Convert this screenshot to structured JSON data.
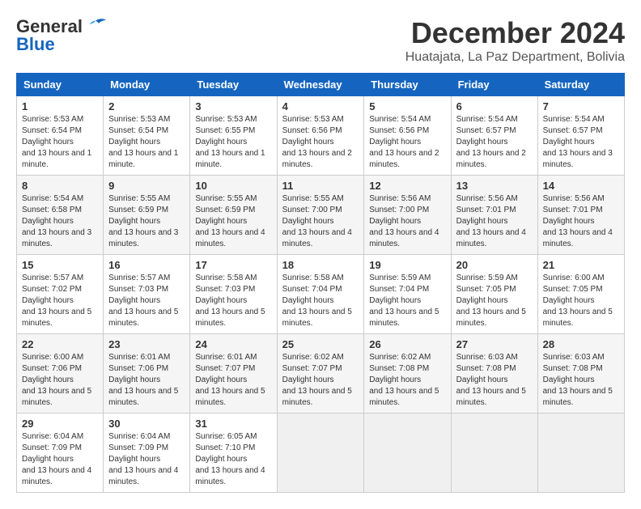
{
  "logo": {
    "line1": "General",
    "line2": "Blue"
  },
  "title": "December 2024",
  "subtitle": "Huatajata, La Paz Department, Bolivia",
  "days_of_week": [
    "Sunday",
    "Monday",
    "Tuesday",
    "Wednesday",
    "Thursday",
    "Friday",
    "Saturday"
  ],
  "weeks": [
    [
      {
        "day": "1",
        "sunrise": "5:53 AM",
        "sunset": "6:54 PM",
        "daylight": "13 hours and 1 minute."
      },
      {
        "day": "2",
        "sunrise": "5:53 AM",
        "sunset": "6:54 PM",
        "daylight": "13 hours and 1 minute."
      },
      {
        "day": "3",
        "sunrise": "5:53 AM",
        "sunset": "6:55 PM",
        "daylight": "13 hours and 1 minute."
      },
      {
        "day": "4",
        "sunrise": "5:53 AM",
        "sunset": "6:56 PM",
        "daylight": "13 hours and 2 minutes."
      },
      {
        "day": "5",
        "sunrise": "5:54 AM",
        "sunset": "6:56 PM",
        "daylight": "13 hours and 2 minutes."
      },
      {
        "day": "6",
        "sunrise": "5:54 AM",
        "sunset": "6:57 PM",
        "daylight": "13 hours and 2 minutes."
      },
      {
        "day": "7",
        "sunrise": "5:54 AM",
        "sunset": "6:57 PM",
        "daylight": "13 hours and 3 minutes."
      }
    ],
    [
      {
        "day": "8",
        "sunrise": "5:54 AM",
        "sunset": "6:58 PM",
        "daylight": "13 hours and 3 minutes."
      },
      {
        "day": "9",
        "sunrise": "5:55 AM",
        "sunset": "6:59 PM",
        "daylight": "13 hours and 3 minutes."
      },
      {
        "day": "10",
        "sunrise": "5:55 AM",
        "sunset": "6:59 PM",
        "daylight": "13 hours and 4 minutes."
      },
      {
        "day": "11",
        "sunrise": "5:55 AM",
        "sunset": "7:00 PM",
        "daylight": "13 hours and 4 minutes."
      },
      {
        "day": "12",
        "sunrise": "5:56 AM",
        "sunset": "7:00 PM",
        "daylight": "13 hours and 4 minutes."
      },
      {
        "day": "13",
        "sunrise": "5:56 AM",
        "sunset": "7:01 PM",
        "daylight": "13 hours and 4 minutes."
      },
      {
        "day": "14",
        "sunrise": "5:56 AM",
        "sunset": "7:01 PM",
        "daylight": "13 hours and 4 minutes."
      }
    ],
    [
      {
        "day": "15",
        "sunrise": "5:57 AM",
        "sunset": "7:02 PM",
        "daylight": "13 hours and 5 minutes."
      },
      {
        "day": "16",
        "sunrise": "5:57 AM",
        "sunset": "7:03 PM",
        "daylight": "13 hours and 5 minutes."
      },
      {
        "day": "17",
        "sunrise": "5:58 AM",
        "sunset": "7:03 PM",
        "daylight": "13 hours and 5 minutes."
      },
      {
        "day": "18",
        "sunrise": "5:58 AM",
        "sunset": "7:04 PM",
        "daylight": "13 hours and 5 minutes."
      },
      {
        "day": "19",
        "sunrise": "5:59 AM",
        "sunset": "7:04 PM",
        "daylight": "13 hours and 5 minutes."
      },
      {
        "day": "20",
        "sunrise": "5:59 AM",
        "sunset": "7:05 PM",
        "daylight": "13 hours and 5 minutes."
      },
      {
        "day": "21",
        "sunrise": "6:00 AM",
        "sunset": "7:05 PM",
        "daylight": "13 hours and 5 minutes."
      }
    ],
    [
      {
        "day": "22",
        "sunrise": "6:00 AM",
        "sunset": "7:06 PM",
        "daylight": "13 hours and 5 minutes."
      },
      {
        "day": "23",
        "sunrise": "6:01 AM",
        "sunset": "7:06 PM",
        "daylight": "13 hours and 5 minutes."
      },
      {
        "day": "24",
        "sunrise": "6:01 AM",
        "sunset": "7:07 PM",
        "daylight": "13 hours and 5 minutes."
      },
      {
        "day": "25",
        "sunrise": "6:02 AM",
        "sunset": "7:07 PM",
        "daylight": "13 hours and 5 minutes."
      },
      {
        "day": "26",
        "sunrise": "6:02 AM",
        "sunset": "7:08 PM",
        "daylight": "13 hours and 5 minutes."
      },
      {
        "day": "27",
        "sunrise": "6:03 AM",
        "sunset": "7:08 PM",
        "daylight": "13 hours and 5 minutes."
      },
      {
        "day": "28",
        "sunrise": "6:03 AM",
        "sunset": "7:08 PM",
        "daylight": "13 hours and 5 minutes."
      }
    ],
    [
      {
        "day": "29",
        "sunrise": "6:04 AM",
        "sunset": "7:09 PM",
        "daylight": "13 hours and 4 minutes."
      },
      {
        "day": "30",
        "sunrise": "6:04 AM",
        "sunset": "7:09 PM",
        "daylight": "13 hours and 4 minutes."
      },
      {
        "day": "31",
        "sunrise": "6:05 AM",
        "sunset": "7:10 PM",
        "daylight": "13 hours and 4 minutes."
      },
      null,
      null,
      null,
      null
    ]
  ]
}
